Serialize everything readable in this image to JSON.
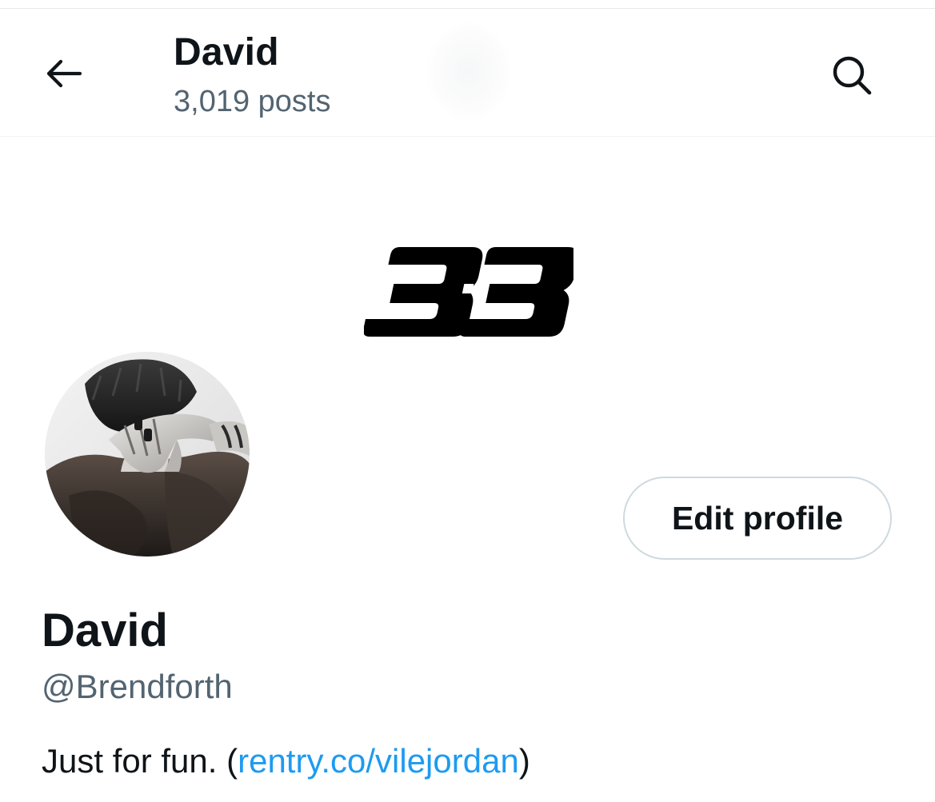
{
  "header": {
    "title": "David",
    "posts_count": "3,019 posts",
    "back_icon": "arrow-left-icon",
    "search_icon": "search-icon"
  },
  "banner": {
    "logo_text": "33"
  },
  "profile": {
    "display_name": "David",
    "handle": "@Brendforth",
    "edit_button_label": "Edit profile",
    "bio": {
      "text_before": "Just for fun. (",
      "link_text": "rentry.co/vilejordan",
      "text_after": ")"
    }
  },
  "colors": {
    "text_primary": "#0f1419",
    "text_secondary": "#536471",
    "link": "#1d9bf0",
    "border": "#cfd9de",
    "background": "#ffffff"
  }
}
